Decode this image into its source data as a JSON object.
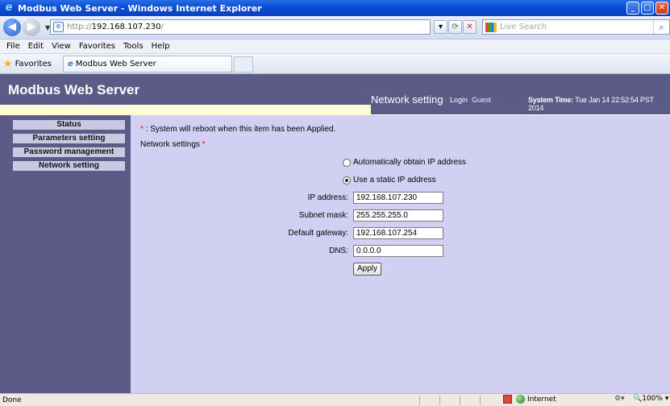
{
  "browser": {
    "title": "Modbus Web Server - Windows Internet Explorer",
    "address_prefix": "http://",
    "address_host": "192.168.107.230",
    "address_suffix": "/",
    "search_placeholder": "Live Search",
    "menu": [
      "File",
      "Edit",
      "View",
      "Favorites",
      "Tools",
      "Help"
    ],
    "favorites_label": "Favorites",
    "tab_title": "Modbus Web Server",
    "status_text": "Done",
    "zone_label": "Internet",
    "zoom_label": "100%"
  },
  "header": {
    "site_title": "Modbus Web Server",
    "page_heading": "Network setting",
    "login_label": "Login",
    "login_user": "Guest",
    "system_time_label": "System Time:",
    "system_time_value": "Tue Jan 14 22:52:54 PST 2014"
  },
  "sidebar": {
    "items": [
      {
        "label": "Status"
      },
      {
        "label": "Parameters setting"
      },
      {
        "label": "Password management"
      },
      {
        "label": "Network setting"
      }
    ]
  },
  "main": {
    "note_asterisk": "*",
    "note_text": " : System will reboot when this item has been Applied.",
    "section_label": "Network settings ",
    "section_asterisk": "*",
    "radio_auto_label": "Automatically obtain IP address",
    "radio_static_label": "Use a static IP address",
    "selected_mode": "static",
    "fields": [
      {
        "label": "IP address:",
        "value": "192.168.107.230"
      },
      {
        "label": "Subnet mask:",
        "value": "255.255.255.0"
      },
      {
        "label": "Default gateway:",
        "value": "192.168.107.254"
      },
      {
        "label": "DNS:",
        "value": "0.0.0.0"
      }
    ],
    "apply_label": "Apply"
  },
  "colors": {
    "header_bg": "#5c5b87",
    "content_bg": "#d1d0f2",
    "sidebar_item_bg": "#cac9e4",
    "required_mark": "#e01010"
  }
}
